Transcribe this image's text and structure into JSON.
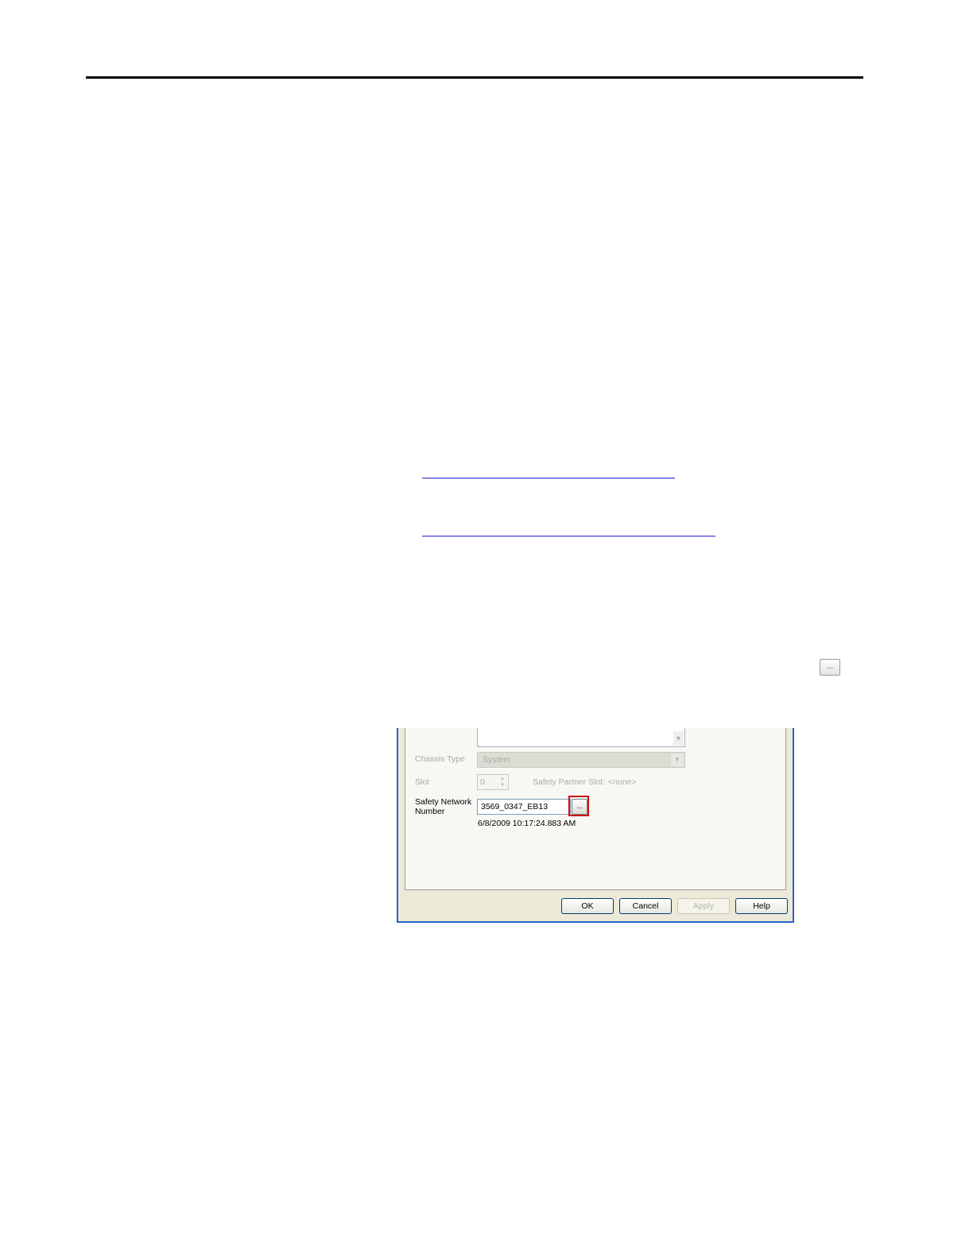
{
  "browse_button": {
    "label": "..."
  },
  "dialog": {
    "chassis_type": {
      "label": "Chassis Type",
      "value": "System"
    },
    "slot": {
      "label": "Slot",
      "value": "0"
    },
    "safety_partner_slot": {
      "label": "Safety Partner Slot:",
      "value": "<none>"
    },
    "safety_network_number": {
      "label_line1": "Safety Network",
      "label_line2": "Number",
      "value": "3569_0347_EB13",
      "browse_label": "...",
      "timestamp": "6/8/2009 10:17:24.883 AM"
    },
    "buttons": {
      "ok": "OK",
      "cancel": "Cancel",
      "apply": "Apply",
      "help": "Help"
    }
  }
}
